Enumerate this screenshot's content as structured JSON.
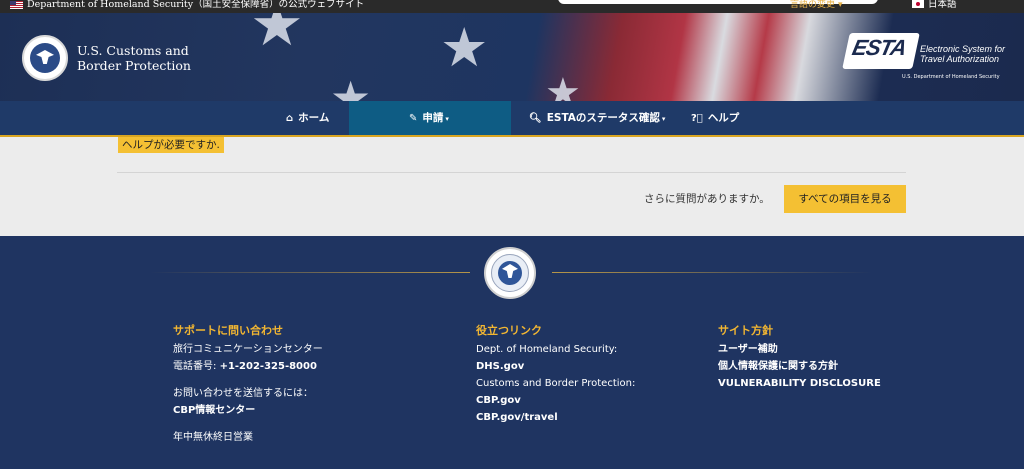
{
  "topbar": {
    "gov_text": "Department of Homeland Security（国土安全保障省）の公式ウェブサイト",
    "lang_change": "言語の変更",
    "lang_current": "日本語"
  },
  "header": {
    "agency_line1": "U.S. Customs and",
    "agency_line2": "Border Protection",
    "esta_mark": "ESTA",
    "esta_line1": "Electronic System for",
    "esta_line2": "Travel Authorization",
    "esta_dhs": "U.S. Department of Homeland Security"
  },
  "nav": {
    "home": "ホーム",
    "apply": "申請",
    "status": "ESTAのステータス確認",
    "help": "ヘルプ"
  },
  "content": {
    "help_tag": "ヘルプが必要ですか.",
    "more_questions": "さらに質問がありますか。",
    "see_all_button": "すべての項目を見る"
  },
  "footer": {
    "contact": {
      "heading": "サポートに問い合わせ",
      "center": "旅行コミュニケーションセンター",
      "phone_label": "電話番号: ",
      "phone": "+1-202-325-8000",
      "send_label": "お問い合わせを送信するには：",
      "info_center": "CBP情報センター",
      "hours": "年中無休終日営業"
    },
    "links": {
      "heading": "役立つリンク",
      "dhs_label": "Dept. of Homeland Security:",
      "dhs_link": "DHS.gov",
      "cbp_label": "Customs and Border Protection:",
      "cbp_link": "CBP.gov",
      "travel_link": "CBP.gov/travel"
    },
    "policy": {
      "heading": "サイト方針",
      "accessibility": "ユーザー補助",
      "privacy": "個人情報保護に関する方針",
      "vulnerability": "VULNERABILITY DISCLOSURE"
    }
  }
}
